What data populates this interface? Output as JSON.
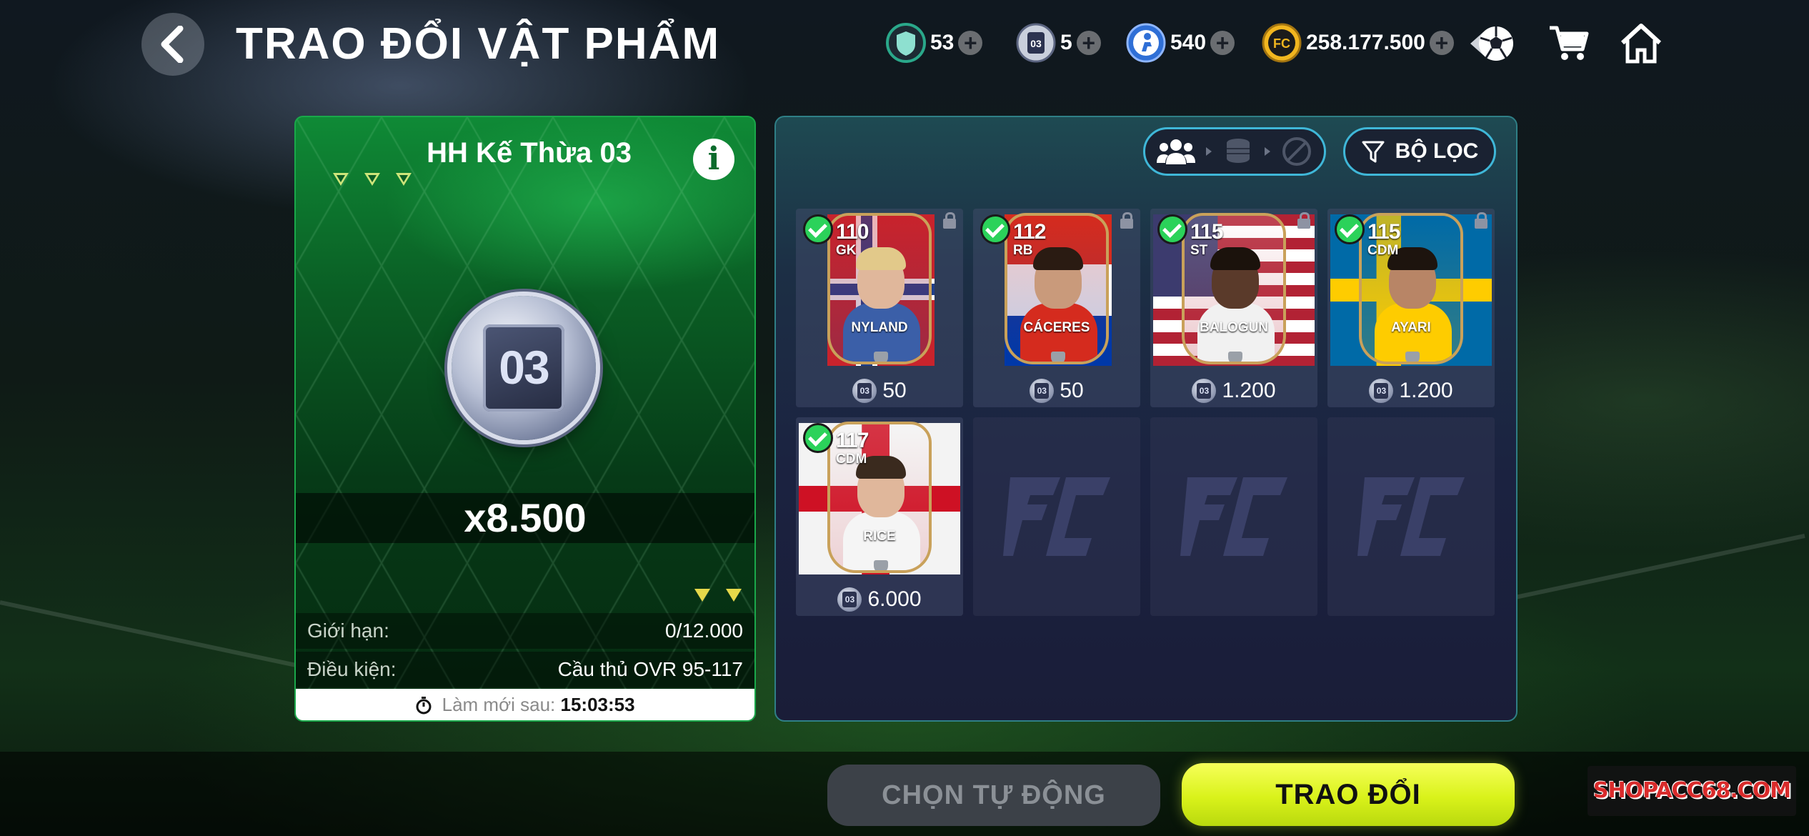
{
  "header": {
    "title": "TRAO ĐỔI VẬT PHẨM",
    "currencies": [
      {
        "name": "shield-token",
        "value": "53",
        "color": "#2aa88a"
      },
      {
        "name": "card-token-03",
        "value": "5",
        "color": "#5b6480"
      },
      {
        "name": "player-coin",
        "value": "540",
        "color": "#2f6fd6"
      },
      {
        "name": "fc-coin",
        "value": "258.177.500",
        "color": "#f2b61f"
      }
    ],
    "icons": [
      "ball-icon",
      "cart-icon",
      "home-icon"
    ]
  },
  "offer": {
    "title": "HH Kế Thừa 03",
    "token_label": "03",
    "quantity": "x8.500",
    "limit_label": "Giới hạn:",
    "limit_value": "0/12.000",
    "condition_label": "Điều kiện:",
    "condition_value": "Cầu thủ OVR 95-117",
    "refresh_label": "Làm mới sau:",
    "refresh_value": "15:03:53"
  },
  "filters": {
    "filter_label": "BỘ LỌC"
  },
  "players": [
    {
      "ovr": "110",
      "pos": "GK",
      "name": "NYLAND",
      "price": "50",
      "flag": "norway",
      "selected": true
    },
    {
      "ovr": "112",
      "pos": "RB",
      "name": "CÁCERES",
      "price": "50",
      "flag": "paraguay",
      "selected": true
    },
    {
      "ovr": "115",
      "pos": "ST",
      "name": "BALOGUN",
      "price": "1.200",
      "flag": "usa",
      "selected": true
    },
    {
      "ovr": "115",
      "pos": "CDM",
      "name": "AYARI",
      "price": "1.200",
      "flag": "sweden",
      "selected": true
    },
    {
      "ovr": "117",
      "pos": "CDM",
      "name": "RICE",
      "price": "6.000",
      "flag": "england",
      "selected": true
    }
  ],
  "token_mini": "03",
  "buttons": {
    "auto": "CHỌN TỰ ĐỘNG",
    "exchange": "TRAO ĐỔI"
  },
  "watermark": "SHOPACC68.COM",
  "colors": {
    "accent_yellow": "#d9f21a",
    "panel_green": "#0f8a36",
    "check_green": "#2bd25a",
    "card_gold": "#c9a15a",
    "outline_cyan": "#3fb7d8"
  }
}
